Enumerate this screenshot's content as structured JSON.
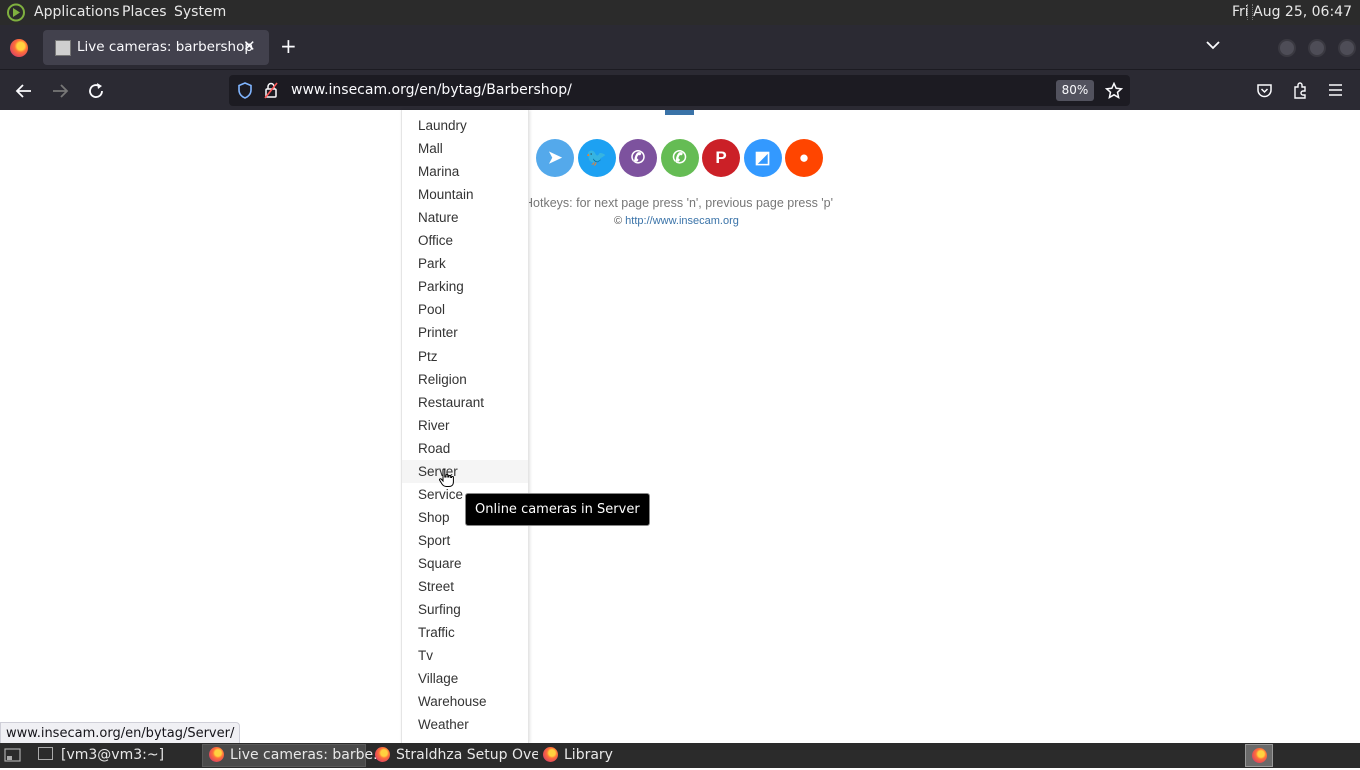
{
  "system_panel": {
    "menus": [
      "Applications",
      "Places",
      "System"
    ],
    "clock": "Fri Aug 25, 06:47"
  },
  "browser": {
    "tab_title": "Live cameras: barbershop",
    "url": "www.insecam.org/en/bytag/Barbershop/",
    "zoom": "80%"
  },
  "page": {
    "categories": [
      "Laundry",
      "Mall",
      "Marina",
      "Mountain",
      "Nature",
      "Office",
      "Park",
      "Parking",
      "Pool",
      "Printer",
      "Ptz",
      "Religion",
      "Restaurant",
      "River",
      "Road",
      "Server",
      "Service",
      "Shop",
      "Sport",
      "Square",
      "Street",
      "Surfing",
      "Traffic",
      "Tv",
      "Village",
      "Warehouse",
      "Weather"
    ],
    "hovered_category": "Server",
    "share_buttons": [
      {
        "name": "telegram",
        "color": "#54a9eb"
      },
      {
        "name": "twitter",
        "color": "#1da1f2"
      },
      {
        "name": "viber",
        "color": "#7d529e"
      },
      {
        "name": "whatsapp",
        "color": "#65bc54"
      },
      {
        "name": "pinterest",
        "color": "#cb2027"
      },
      {
        "name": "delicious",
        "color": "#3399ff"
      },
      {
        "name": "reddit",
        "color": "#ff4500"
      }
    ],
    "hotkeys_text": "Hotkeys: for next page press 'n', previous page press 'p'",
    "copyright_symbol": "©",
    "copyright_link": "http://www.insecam.org",
    "tooltip": "Online cameras in Server",
    "status_url": "www.insecam.org/en/bytag/Server/"
  },
  "taskbar": {
    "items": [
      "[vm3@vm3:~]",
      "Live cameras: barbe...",
      "Straldhza Setup Ove...",
      "Library"
    ]
  }
}
